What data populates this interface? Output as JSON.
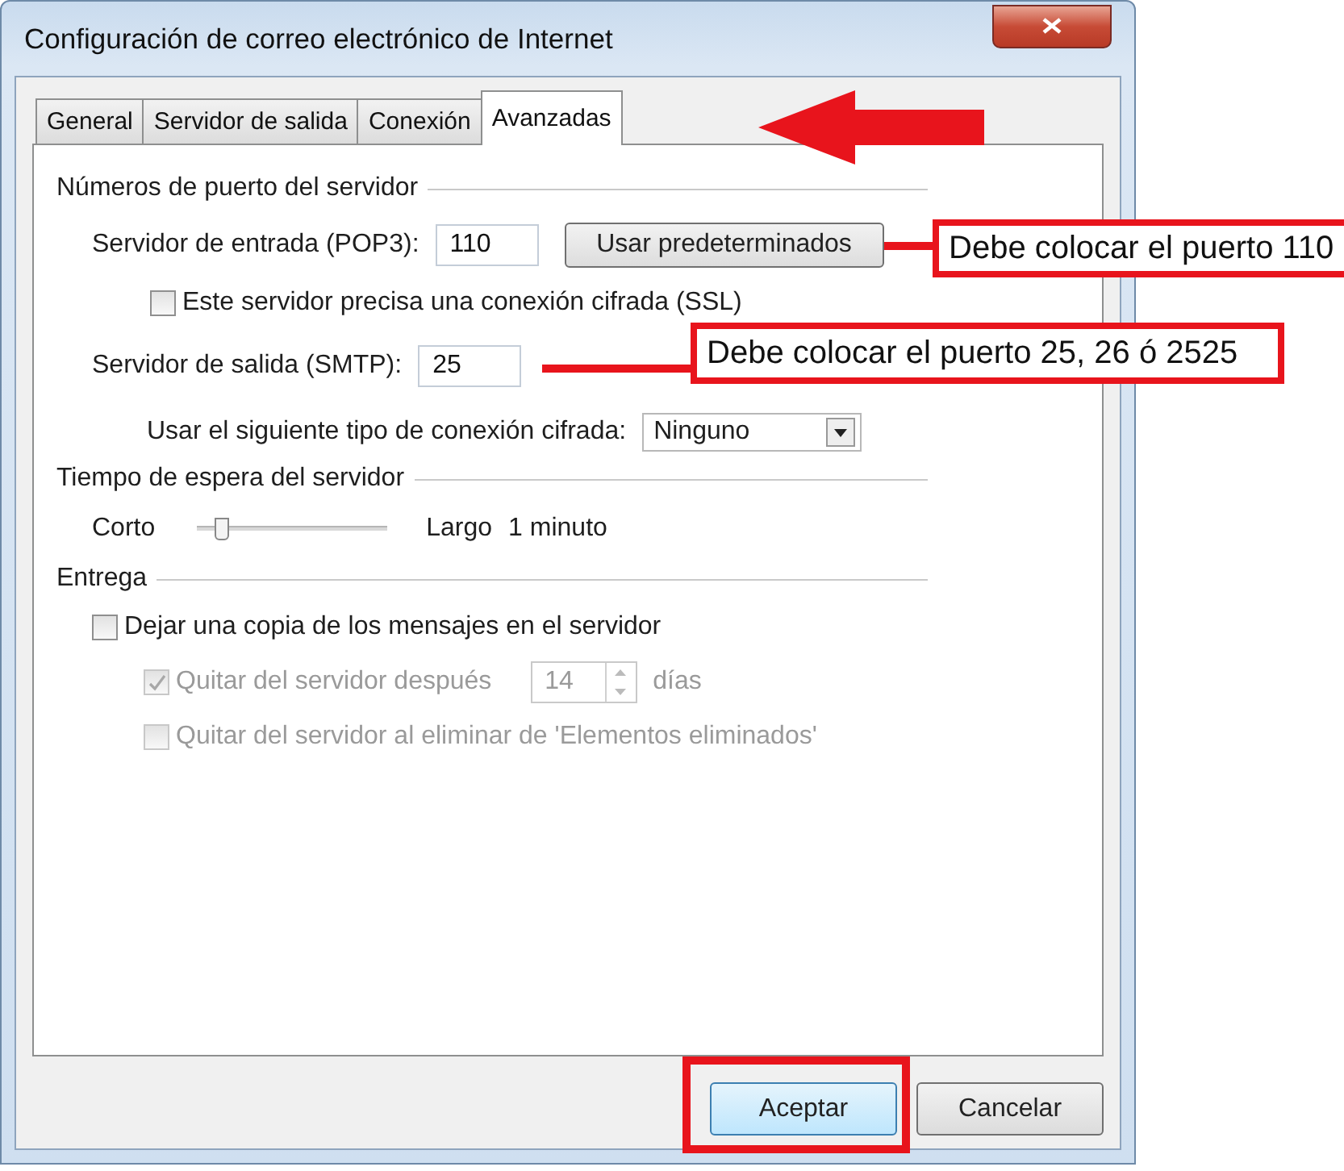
{
  "window": {
    "title": "Configuración de correo electrónico de Internet"
  },
  "tabs": [
    {
      "label": "General",
      "selected": false
    },
    {
      "label": "Servidor de salida",
      "selected": false
    },
    {
      "label": "Conexión",
      "selected": false
    },
    {
      "label": "Avanzadas",
      "selected": true
    }
  ],
  "ports": {
    "heading": "Números de puerto del servidor",
    "incoming": {
      "label": "Servidor de entrada (POP3):",
      "value": "110"
    },
    "defaults_button": "Usar predeterminados",
    "ssl": {
      "label": "Este servidor precisa una conexión cifrada (SSL)",
      "checked": false
    },
    "outgoing": {
      "label": "Servidor de salida (SMTP):",
      "value": "25"
    },
    "encryption": {
      "label": "Usar el siguiente tipo de conexión cifrada:",
      "value": "Ninguno"
    }
  },
  "timeout": {
    "heading": "Tiempo de espera del servidor",
    "min_label": "Corto",
    "max_label": "Largo",
    "level": 0.1,
    "reading": "1 minuto"
  },
  "delivery": {
    "heading": "Entrega",
    "leave_copy": {
      "label": "Dejar una copia de los mensajes en el servidor",
      "checked": false,
      "disabled": false
    },
    "remove_after": {
      "label": "Quitar del servidor después",
      "checked": true,
      "disabled": true,
      "value": "14",
      "unit": "días"
    },
    "remove_deleted": {
      "label": "Quitar del servidor al eliminar de 'Elementos eliminados'",
      "checked": false,
      "disabled": true
    }
  },
  "buttons": [
    {
      "label": "Aceptar",
      "default": true
    },
    {
      "label": "Cancelar",
      "default": false
    }
  ],
  "annotations": [
    {
      "text": "Debe colocar el puerto 110"
    },
    {
      "text": "Debe colocar el puerto 25, 26 ó 2525"
    }
  ]
}
